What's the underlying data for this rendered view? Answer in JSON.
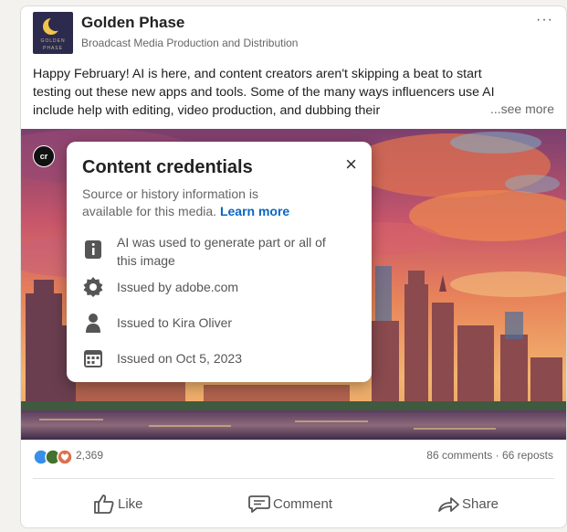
{
  "post": {
    "org_name": "Golden Phase",
    "logo_top": "GOLDEN",
    "logo_bottom": "PHASE",
    "org_subtitle": "Broadcast Media Production and Distribution",
    "menu": "···",
    "text_line1": "Happy February! AI is here, and content creators aren't skipping a beat to start",
    "text_line2": "testing out these new apps and tools. Some of the many ways influencers use AI",
    "text_line3": "include help with editing, video production, and dubbing their",
    "see_more": "...see more"
  },
  "badge": "cr",
  "credentials": {
    "title": "Content credentials",
    "close": "×",
    "description": "Source or history information is available for this media.",
    "learn_more": "Learn more",
    "rows": [
      {
        "icon": "info-icon",
        "text": "AI was used to generate part or all of this image"
      },
      {
        "icon": "verified-seal-icon",
        "text": "Issued by adobe.com"
      },
      {
        "icon": "person-icon",
        "text": "Issued to Kira Oliver"
      },
      {
        "icon": "calendar-icon",
        "text": "Issued on Oct 5, 2023"
      }
    ]
  },
  "stats": {
    "reaction_count": "2,369",
    "comments_reposts": "86 comments · 66 reposts"
  },
  "actions": {
    "like": "Like",
    "comment": "Comment",
    "share": "Share"
  }
}
